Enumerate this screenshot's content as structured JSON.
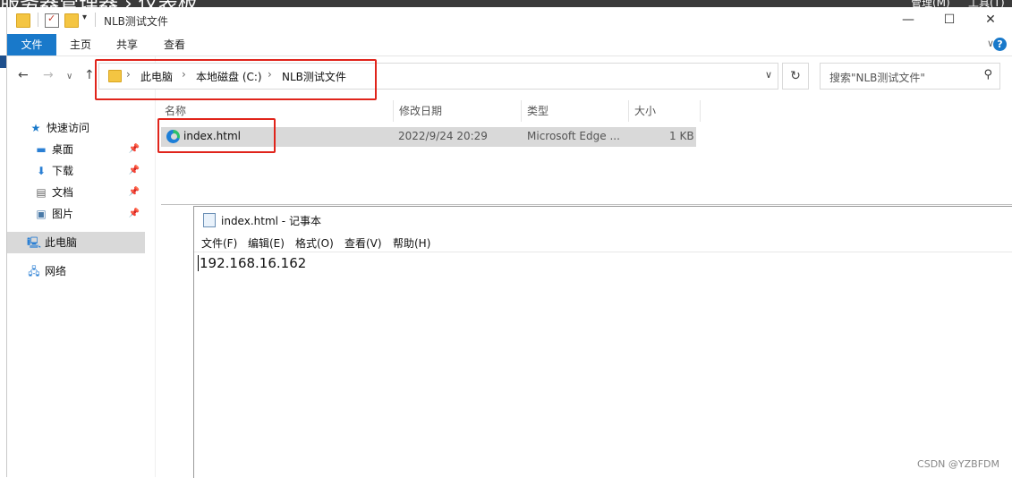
{
  "background": {
    "title_fragment": "服务器管理器 › 仪表板",
    "right_fragment_1": "管理(M)",
    "right_fragment_2": "工具(T)"
  },
  "explorer": {
    "window_title": "NLB测试文件",
    "ribbon_tabs": [
      "文件",
      "主页",
      "共享",
      "查看"
    ],
    "breadcrumb": [
      "此电脑",
      "本地磁盘 (C:)",
      "NLB测试文件"
    ],
    "search_placeholder": "搜索\"NLB测试文件\"",
    "columns": [
      "名称",
      "修改日期",
      "类型",
      "大小"
    ],
    "files": [
      {
        "name": "index.html",
        "modified": "2022/9/24 20:29",
        "type": "Microsoft Edge ...",
        "size": "1 KB"
      }
    ],
    "sidebar": {
      "quick_access": "快速访问",
      "desktop": "桌面",
      "downloads": "下载",
      "documents": "文档",
      "pictures": "图片",
      "this_pc": "此电脑",
      "network": "网络"
    },
    "accent": "#1979ca"
  },
  "notepad": {
    "title": "index.html - 记事本",
    "menu": [
      "文件(F)",
      "编辑(E)",
      "格式(O)",
      "查看(V)",
      "帮助(H)"
    ],
    "content": "192.168.16.162"
  },
  "highlight_color": "#e0241b",
  "watermark": "CSDN @YZBFDM"
}
